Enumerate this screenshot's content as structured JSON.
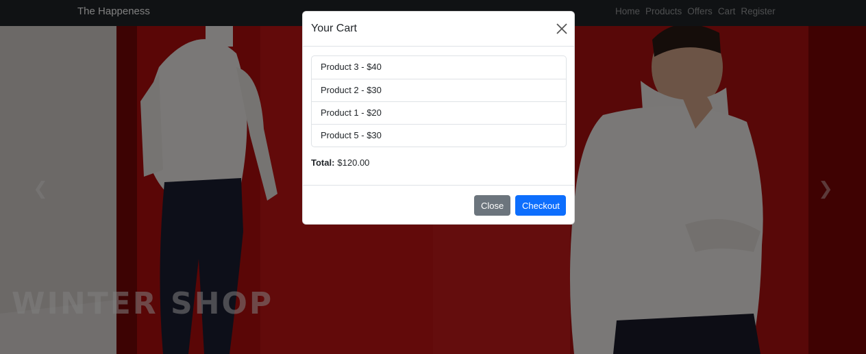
{
  "navbar": {
    "brand": "The Happeness",
    "links": [
      "Home",
      "Products",
      "Offers",
      "Cart",
      "Register"
    ]
  },
  "hero": {
    "title": "WINTER SHOP",
    "prev_icon": "chevron-left-icon",
    "next_icon": "chevron-right-icon"
  },
  "modal": {
    "title": "Your Cart",
    "close_icon": "close-icon",
    "items": [
      "Product 3 - $40",
      "Product 2 - $30",
      "Product 1 - $20",
      "Product 5 - $30"
    ],
    "total_label": "Total:",
    "total_value": "$120.00",
    "close_label": "Close",
    "checkout_label": "Checkout"
  },
  "colors": {
    "navbar": "#212529",
    "primary": "#0d6efd",
    "secondary": "#6c757d",
    "backdrop_red": "#8a0000"
  }
}
